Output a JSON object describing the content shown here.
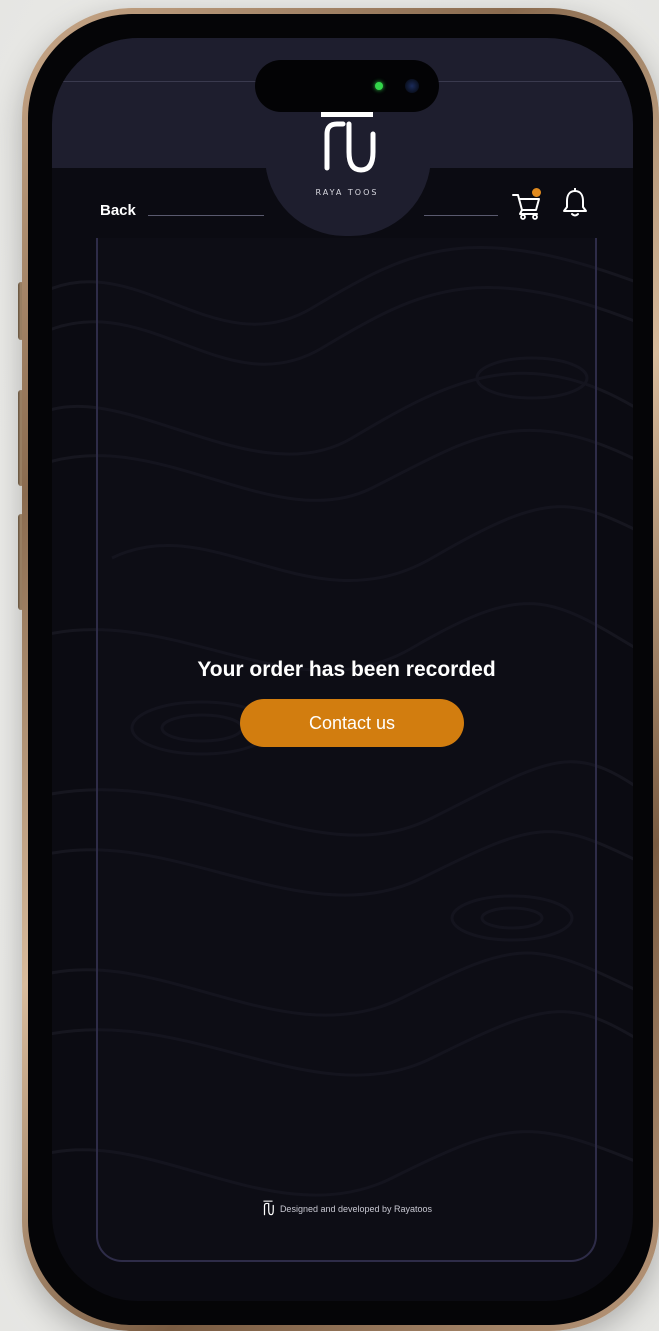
{
  "header": {
    "brand_name": "RAYA TOOS",
    "back_label": "Back",
    "cart_icon": "cart-icon",
    "bell_icon": "bell-icon",
    "cart_has_notification": true
  },
  "main": {
    "message": "Your order has been recorded",
    "contact_button_label": "Contact us"
  },
  "footer": {
    "credit": "Designed and developed by Rayatoos"
  },
  "colors": {
    "accent": "#d27d0f",
    "badge": "#e08a1e",
    "header_bg": "#1e1e2e",
    "screen_bg": "#0b0b12",
    "panel_border": "#2e2c48",
    "phone_frame": "#b9987a"
  }
}
